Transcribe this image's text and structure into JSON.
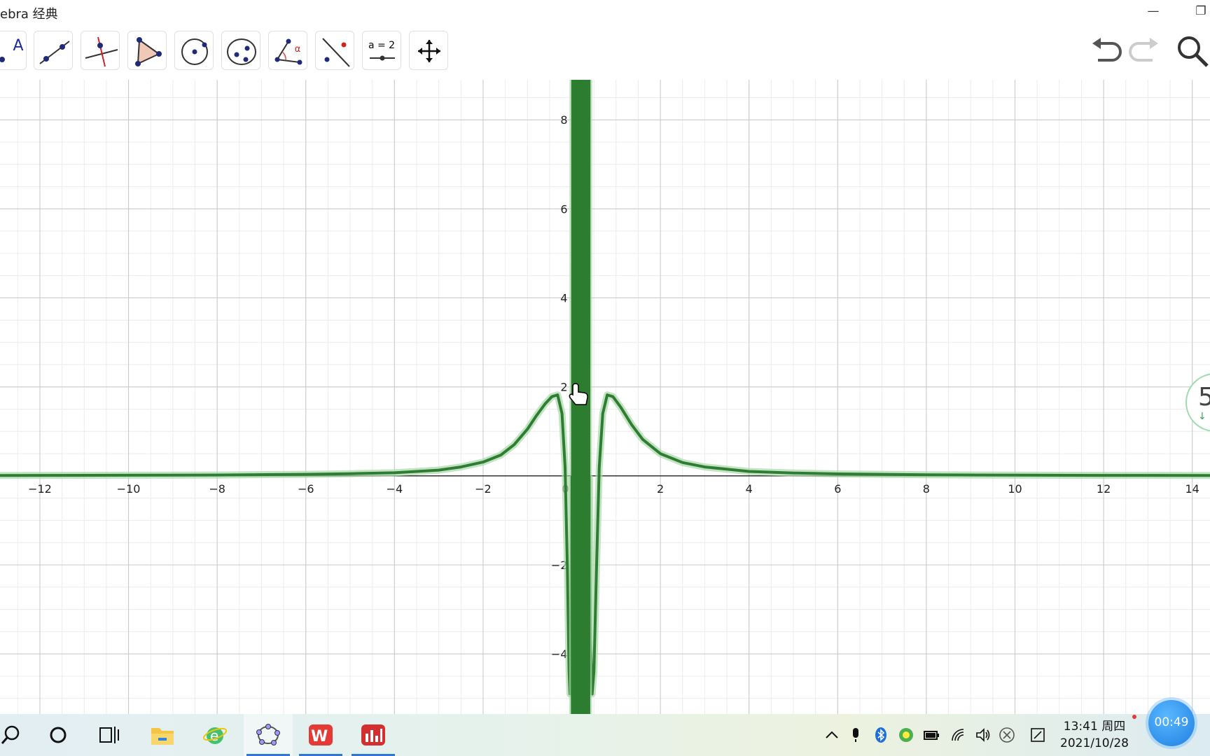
{
  "window": {
    "title": "ebra 经典",
    "minimize_glyph": "—",
    "restore_glyph": "❐"
  },
  "toolbar": {
    "tools": [
      {
        "name": "point-tool",
        "icon": "point-a-icon",
        "label": "A"
      },
      {
        "name": "line-tool",
        "icon": "line-through-points-icon"
      },
      {
        "name": "perpendicular-tool",
        "icon": "perpendicular-line-icon"
      },
      {
        "name": "polygon-tool",
        "icon": "polygon-icon"
      },
      {
        "name": "circle-tool",
        "icon": "circle-center-point-icon"
      },
      {
        "name": "conic-tool",
        "icon": "ellipse-icon"
      },
      {
        "name": "angle-tool",
        "icon": "angle-icon",
        "label": "α"
      },
      {
        "name": "reflect-tool",
        "icon": "reflect-about-line-icon"
      },
      {
        "name": "slider-tool",
        "icon": "slider-icon",
        "label": "a = 2"
      },
      {
        "name": "move-view-tool",
        "icon": "move-graphics-view-icon"
      }
    ],
    "right": [
      {
        "name": "undo-button",
        "icon": "undo-icon"
      },
      {
        "name": "redo-button",
        "icon": "redo-icon"
      },
      {
        "name": "search-button",
        "icon": "search-icon"
      }
    ]
  },
  "chart_data": {
    "type": "line",
    "xlim": [
      -12.9,
      14.4
    ],
    "ylim": [
      -5.35,
      8.9
    ],
    "x_ticks": [
      -12,
      -10,
      -8,
      -6,
      -4,
      -2,
      2,
      4,
      6,
      8,
      10,
      12,
      14
    ],
    "y_ticks": [
      -4,
      -2,
      2,
      4,
      6,
      8
    ],
    "origin_label": "0",
    "grid": true,
    "series": [
      {
        "color": "#2e7d32",
        "shape": "tail near 0 for |x|>3, peaks ≈1.8 at x≈-0.3 and x≈0.75, dips to ≈-4.9 at x≈-0.05 and x≈0.5, dense oscillation between x≈0 and x≈0.4 spanning beyond the visible y range",
        "points": [
          [
            -12.9,
            0.01
          ],
          [
            -10,
            0.015
          ],
          [
            -8,
            0.02
          ],
          [
            -6,
            0.035
          ],
          [
            -5,
            0.05
          ],
          [
            -4,
            0.07
          ],
          [
            -3,
            0.13
          ],
          [
            -2.5,
            0.2
          ],
          [
            -2,
            0.31
          ],
          [
            -1.6,
            0.47
          ],
          [
            -1.3,
            0.7
          ],
          [
            -1.0,
            1.05
          ],
          [
            -0.8,
            1.35
          ],
          [
            -0.6,
            1.62
          ],
          [
            -0.45,
            1.78
          ],
          [
            -0.32,
            1.82
          ],
          [
            -0.22,
            1.4
          ],
          [
            -0.15,
            0.2
          ],
          [
            -0.1,
            -2.0
          ],
          [
            -0.06,
            -4.4
          ],
          [
            -0.04,
            -4.9
          ],
          [
            -0.02,
            -3.6
          ],
          [
            0.0,
            0.0
          ]
        ]
      }
    ]
  },
  "side_widget": {
    "number": "5",
    "arrow": "↓"
  },
  "taskbar": {
    "items": [
      "search-icon",
      "cortana-icon",
      "task-view-icon",
      "file-explorer-icon",
      "ie-browser-icon",
      "geogebra-icon",
      "wps-office-icon",
      "stock-app-icon"
    ],
    "tray": [
      "show-hidden-icons-icon",
      "microphone-icon",
      "bluetooth-icon",
      "app-tray-icon",
      "battery-icon",
      "wifi-icon",
      "volume-icon",
      "close-circle-icon",
      "pen-icon"
    ],
    "clock_time": "13:41 周四",
    "clock_date": "2021/10/28",
    "recording_time": "00:49"
  }
}
